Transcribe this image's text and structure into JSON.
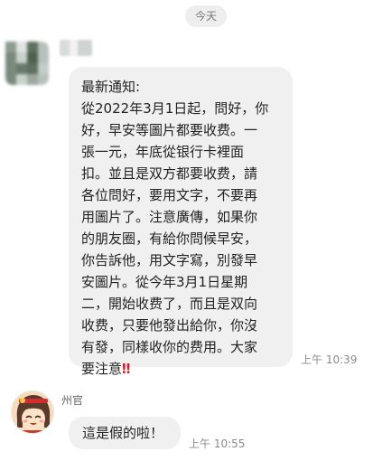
{
  "date_divider": "今天",
  "messages": [
    {
      "lines": [
        "最新通知:",
        "從2022年3月1日起，問好，你",
        "好，早安等圖片都要收费。一",
        "張一元，年底從银行卡裡面",
        "扣。並且是双方都要收费，請",
        "各位問好，要用文字，不要再",
        "用圖片了。注意廣傳，如果你",
        "的朋友圈，有給你問候早安，",
        "你告訴他，用文字寫，別發早",
        "安圖片。從今年3月1日星期",
        "二，開始收费了，而且是双向",
        "收费，只要他發出給你，你沒",
        "有發，同樣收你的费用。大家",
        "要注意"
      ],
      "emphasis": "‼",
      "time": "上午 10:39"
    },
    {
      "sender": "州官",
      "text": "這是假的啦！",
      "time": "上午 10:55"
    }
  ],
  "colors": {
    "bubble": "#f0f0f1",
    "timestamp": "#8c8c8c",
    "emphasis": "#e0192a"
  },
  "icons": {
    "sender1_avatar": "blurred-avatar",
    "sender2_avatar": "cartoon-girl-avatar"
  }
}
